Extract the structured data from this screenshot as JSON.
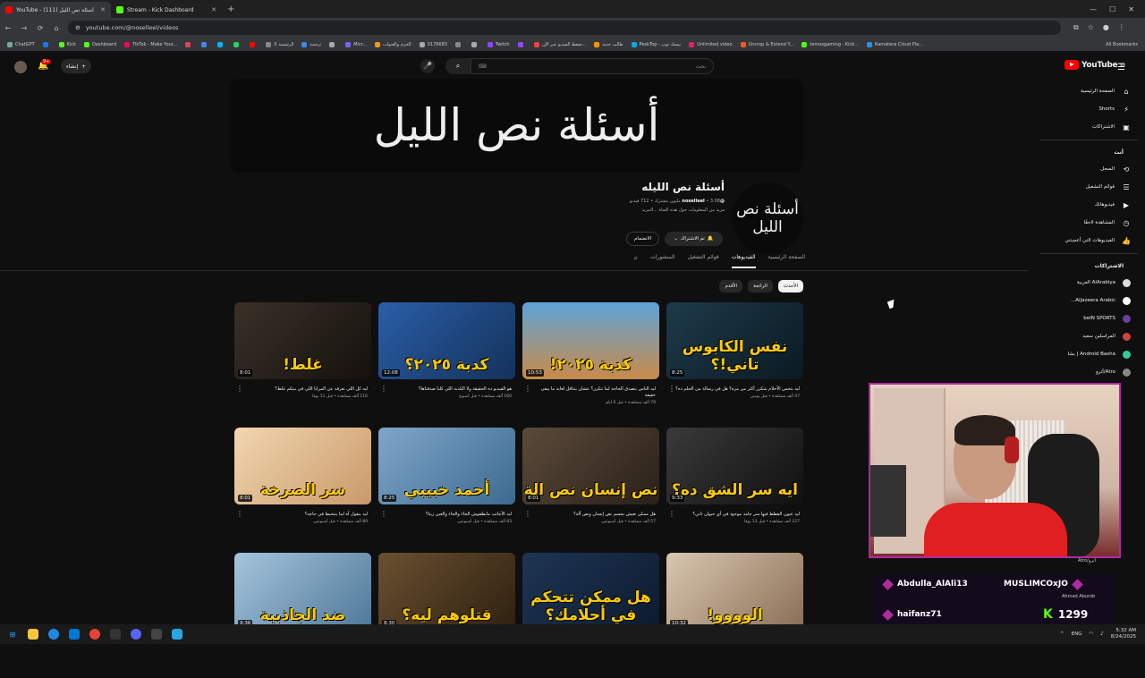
{
  "browser": {
    "tabs": [
      {
        "title": "YouTube - أسئلة نص الليل (111)",
        "active": true,
        "color": "#ff0000"
      },
      {
        "title": "Stream - Kick Dashboard",
        "active": false,
        "color": "#53fc18"
      }
    ],
    "new_tab": "+",
    "url": "youtube.com/@noselleel/videos",
    "bookmarks": [
      {
        "label": "ChatGPT",
        "color": "#74aa9c"
      },
      {
        "label": "",
        "color": "#1877f2"
      },
      {
        "label": "Kick",
        "color": "#53fc18"
      },
      {
        "label": "Dashboard",
        "color": "#53fc18"
      },
      {
        "label": "TikTok - Make Your...",
        "color": "#ff0050"
      },
      {
        "label": "",
        "color": "#e4405f"
      },
      {
        "label": "",
        "color": "#4285f4"
      },
      {
        "label": "",
        "color": "#00b4ff"
      },
      {
        "label": "",
        "color": "#25d366"
      },
      {
        "label": "",
        "color": "#ff0000"
      },
      {
        "label": "X الرئيسية",
        "color": "#888888"
      },
      {
        "label": "ترجمة",
        "color": "#4285f4"
      },
      {
        "label": "",
        "color": "#aaaaaa"
      },
      {
        "label": "Micr...",
        "color": "#7b61ff"
      },
      {
        "label": "الحزم والقنوات",
        "color": "#ff9800"
      },
      {
        "label": "0176683",
        "color": "#aaaaaa"
      },
      {
        "label": "",
        "color": "#888888"
      },
      {
        "label": "",
        "color": "#aaaaaa"
      },
      {
        "label": "Twitch",
        "color": "#9146ff"
      },
      {
        "label": "",
        "color": "#9146ff"
      },
      {
        "label": "ضغط الفيديو عبر الإن...",
        "color": "#f44336"
      },
      {
        "label": "طالب جديد",
        "color": "#ff9800"
      },
      {
        "label": "PeskTop - نيسك توب",
        "color": "#03a9f4"
      },
      {
        "label": "Unlimited video",
        "color": "#e91e63"
      },
      {
        "label": "Uncrop & Extend Y...",
        "color": "#ff5722"
      },
      {
        "label": "temoxgaming - Kick...",
        "color": "#53fc18"
      },
      {
        "label": "Kamatera Cloud Pla...",
        "color": "#2196f3"
      }
    ],
    "all_bookmarks": "All Bookmarks"
  },
  "header": {
    "search_placeholder": "بحث",
    "create_label": "إنشاء",
    "notif_count": "9+",
    "logo_text": "YouTube",
    "logo_suffix": "EG"
  },
  "sidebar": {
    "items": [
      {
        "label": "الصفحة الرئيسية",
        "icon": "home-icon",
        "glyph": "⌂"
      },
      {
        "label": "Shorts",
        "icon": "shorts-icon",
        "glyph": "⚡"
      },
      {
        "label": "الاشتراكات",
        "icon": "subscriptions-icon",
        "glyph": "▣"
      }
    ],
    "you_header": "أنت",
    "you_items": [
      {
        "label": "السجل",
        "icon": "history-icon",
        "glyph": "⟲"
      },
      {
        "label": "قوائم التشغيل",
        "icon": "playlist-icon",
        "glyph": "☰"
      },
      {
        "label": "فيديوهاتك",
        "icon": "your-videos-icon",
        "glyph": "▶"
      },
      {
        "label": "المشاهدة لاحقًا",
        "icon": "watch-later-icon",
        "glyph": "◷"
      },
      {
        "label": "الفيديوهات التي أعجبتني",
        "icon": "liked-icon",
        "glyph": "👍"
      }
    ],
    "subs_header": "الاشتراكات",
    "subs": [
      {
        "label": "AlArabiya العربية",
        "color": "#dddddd"
      },
      {
        "label": "AlJazeera Arabic...",
        "color": "#ffffff"
      },
      {
        "label": "beIN SPORTS",
        "color": "#6b3fa0"
      },
      {
        "label": "المراسلين سعيد",
        "color": "#c44"
      },
      {
        "label": "Android Basha | بشا",
        "color": "#3c9"
      },
      {
        "label": "Atro/أترو",
        "color": "#888"
      }
    ]
  },
  "channel": {
    "banner_text": "أسئلة نص الليل",
    "avatar_text": "أسئلة نص الليل",
    "name": "أسئلة نص الليله",
    "handle": "@noselleel",
    "stats": "3.08 مليون مشترك • 712 فيديو",
    "description": "مزيد من المعلومات حول هذه القناة ...المزيد",
    "subscribed_label": "تم الاشتراك",
    "join_label": "الانضمام",
    "tabs": [
      "الصفحة الرئيسية",
      "الفيديوهات",
      "قوائم التشغيل",
      "المنشورات"
    ],
    "active_tab": 1,
    "chips": [
      "الأحدث",
      "الرائجة",
      "الأقدم"
    ]
  },
  "videos": [
    {
      "thumb_text": "نفس الكابوس تاني!؟",
      "duration": "8:25",
      "title": "ليه بنحس الأحلام بتتكرر أكثر من مرة؟ هل في رسالة من الحلم ده؟",
      "meta": "47 ألف مشاهدة • قبل يومين",
      "bg": "linear-gradient(135deg,#1d3a4a,#0b1a22)"
    },
    {
      "thumb_text": "كدبة ٢٠٢٥!",
      "duration": "10:53",
      "title": "ليه الناس بتصدق الحاجة لما تتكرر؟ عشان يتناقل لغاية ما يبقى حقيقة",
      "meta": "79 ألف مشاهدة • قبل 6 أيام",
      "bg": "linear-gradient(180deg,#5da3d6,#c98a4a)"
    },
    {
      "thumb_text": "كدبة ٢٠٢٥؟",
      "duration": "12:08",
      "title": "هو الفيديو ده الحقيقة ولا الكدبة اللي كلنا صدقناها؟",
      "meta": "160 ألف مشاهدة • قبل أسبوع",
      "bg": "linear-gradient(135deg,#2a5ea8,#14325a)"
    },
    {
      "thumb_text": "غلط!",
      "duration": "8:01",
      "title": "ليه كل اللي تعرفه عن المرايا اللي في بيتكم غلط؟",
      "meta": "116 ألف مشاهدة • قبل 11 يومًا",
      "bg": "linear-gradient(135deg,#3a3028,#15110d)"
    },
    {
      "thumb_text": "ايه سر الشق ده؟",
      "duration": "9:33",
      "title": "ليه عيون القطط فيها سر جامد موجود في أي حيوان تاني؟",
      "meta": "127 ألف مشاهدة • قبل 13 يومًا",
      "bg": "linear-gradient(135deg,#3a3a3a,#101010)"
    },
    {
      "thumb_text": "نص إنسان نص الة",
      "duration": "8:01",
      "title": "هل ممكن نعيش بجسم نص إنسان ونص آلة؟",
      "meta": "57 ألف مشاهدة • قبل أسبوعين",
      "bg": "linear-gradient(135deg,#5a4a3a,#2a2018)"
    },
    {
      "thumb_text": "أحمد خبيبي",
      "duration": "8:25",
      "title": "ليه الأجانب مانطقوش الحاء والخاء والعين زينا؟",
      "meta": "83 ألف مشاهدة • قبل أسبوعين",
      "bg": "linear-gradient(135deg,#7fa6c8,#3d6a90)"
    },
    {
      "thumb_text": "سر الصرخة",
      "duration": "8:01",
      "title": "ليه بنقول آه لما بنتخبط في حاجة؟",
      "meta": "80 ألف مشاهدة • قبل أسبوعين",
      "bg": "linear-gradient(135deg,#f2d6b0,#c89a6a)"
    },
    {
      "thumb_text": "الوووو!",
      "duration": "10:32",
      "title": "",
      "meta": "",
      "bg": "linear-gradient(135deg,#d9c7b0,#8a6e56)"
    },
    {
      "thumb_text": "هل ممكن تتحكم في أحلامك؟",
      "duration": "",
      "title": "",
      "meta": "",
      "bg": "linear-gradient(135deg,#1e3554,#0d1a2e)"
    },
    {
      "thumb_text": "قتلوهم ليه؟",
      "duration": "8:30",
      "title": "",
      "meta": "",
      "bg": "linear-gradient(135deg,#6a5030,#2e2010)"
    },
    {
      "thumb_text": "ضد الجاذبية",
      "duration": "9:36",
      "title": "",
      "meta": "",
      "bg": "linear-gradient(135deg,#a6c4dc,#4e7898)"
    }
  ],
  "stream_overlay": {
    "label": "Atro/أترو",
    "chat_row1_a": "Abdulla_AlAli13",
    "chat_row1_b": "MUSLIMCOxJO",
    "chat_row2_a": "haifanz71",
    "chat_row2_b": "1299",
    "chat_sub": "Ahmad Aburob"
  },
  "taskbar": {
    "lang": "ENG",
    "time": "5:32 AM",
    "date": "8/24/2025"
  }
}
